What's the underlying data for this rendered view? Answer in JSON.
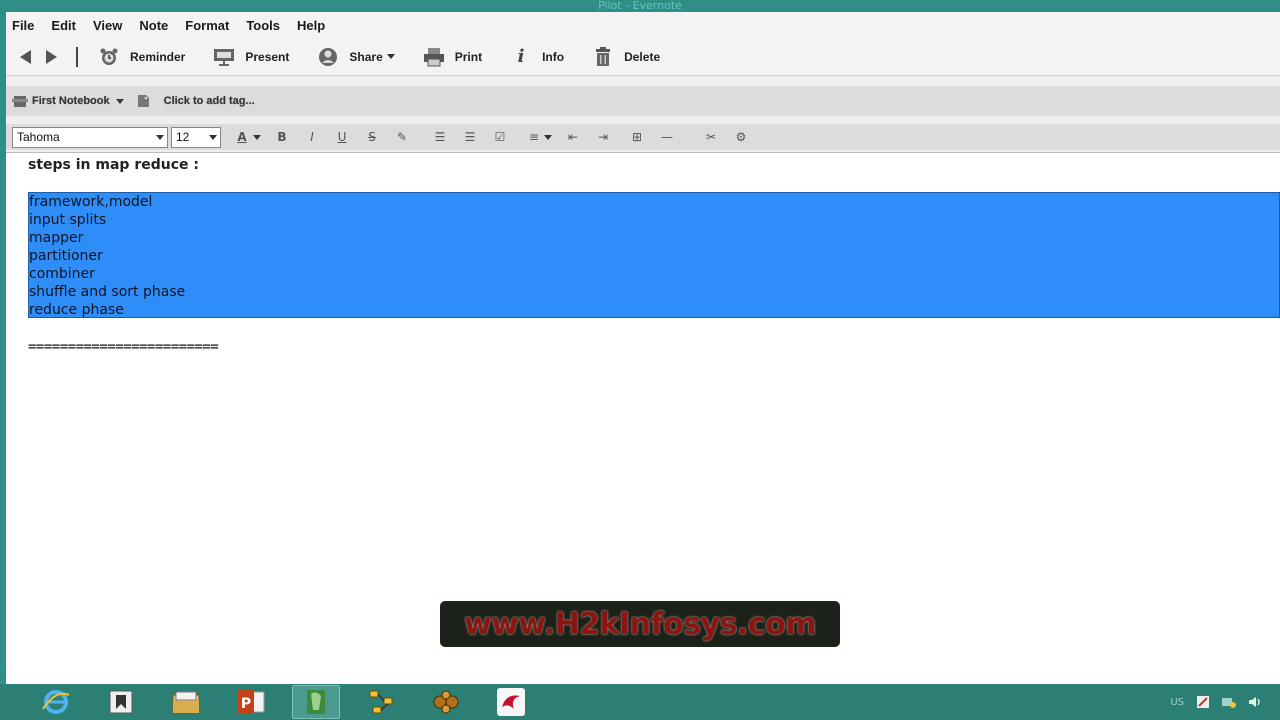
{
  "window": {
    "title": "Pilot - Evernote"
  },
  "menu": [
    "File",
    "Edit",
    "View",
    "Note",
    "Format",
    "Tools",
    "Help"
  ],
  "toolbar": {
    "reminder": "Reminder",
    "present": "Present",
    "share": "Share",
    "print": "Print",
    "info": "Info",
    "delete": "Delete"
  },
  "notebook": {
    "name": "First Notebook",
    "tag_placeholder": "Click to add tag..."
  },
  "format": {
    "font": "Tahoma",
    "size": "12"
  },
  "note": {
    "heading": "steps in map reduce :",
    "selected_lines": [
      "framework,model",
      "input splits",
      "mapper",
      "partitioner",
      "combiner",
      "shuffle and sort phase",
      "reduce phase"
    ],
    "separator": "========================"
  },
  "watermark": "www.H2kInfosys.com",
  "tray": {
    "language": "US"
  },
  "colors": {
    "selection": "#2f8dfa",
    "taskbar": "#2c7f74",
    "watermark_text": "#8a1612"
  }
}
